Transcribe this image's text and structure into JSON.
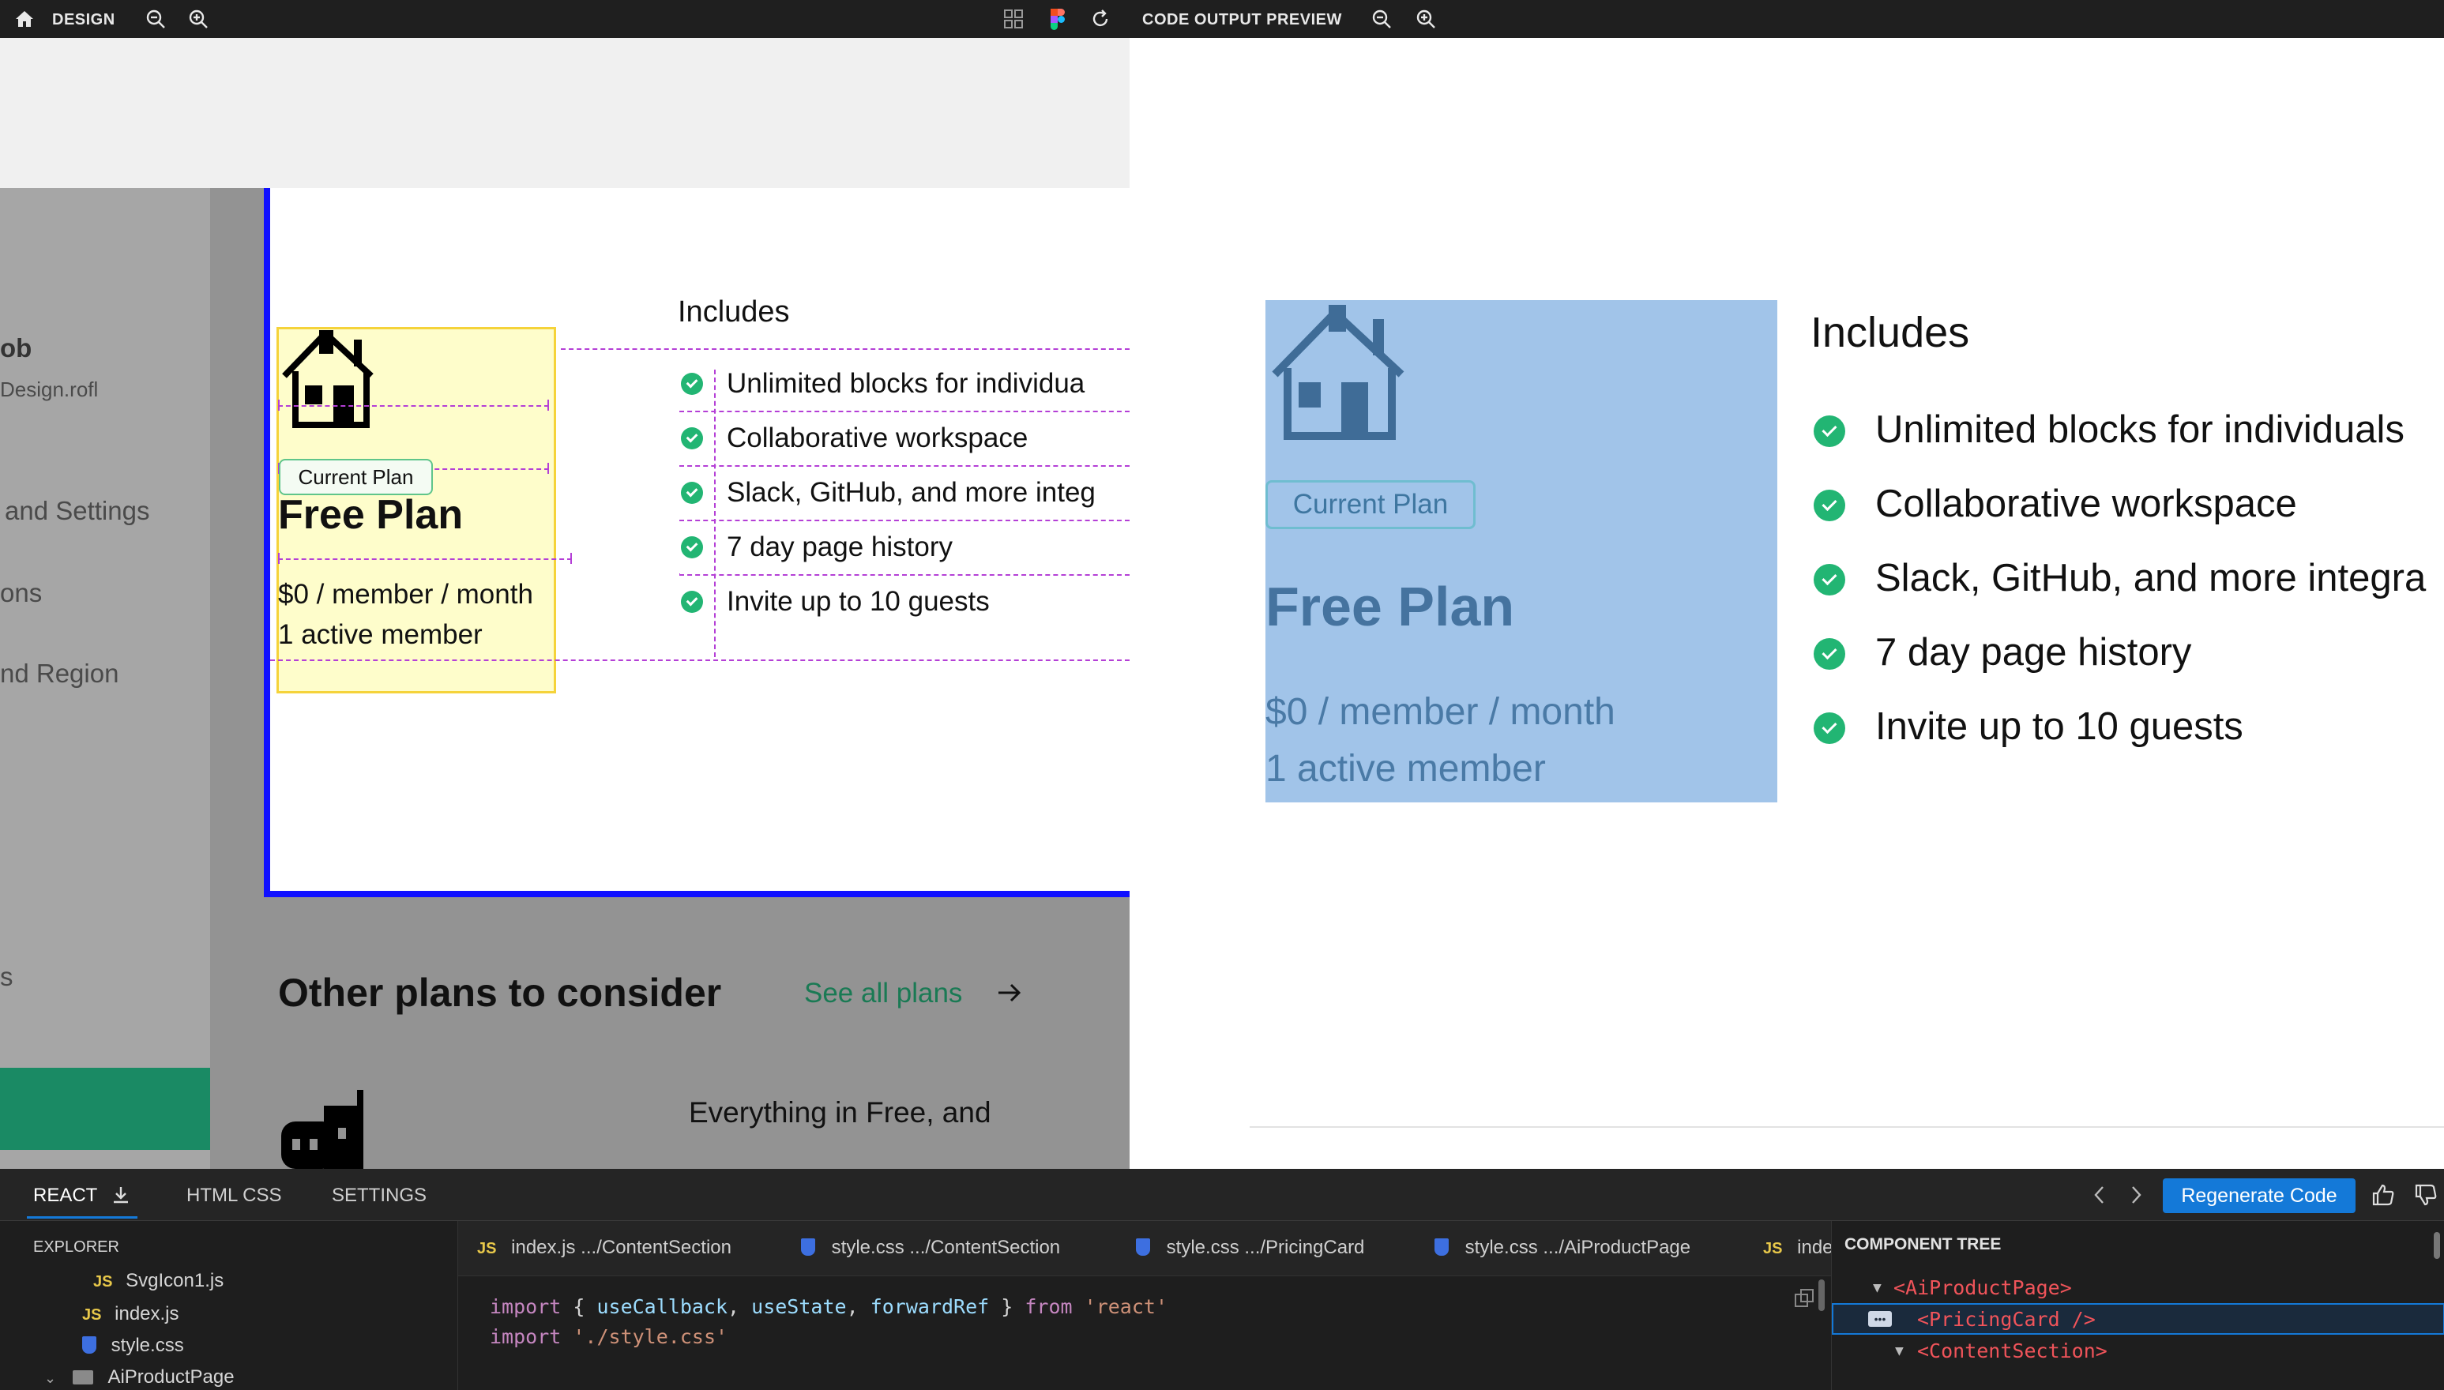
{
  "design_panel": {
    "title": "DESIGN",
    "sidebar": {
      "user_fragment": "ob",
      "subtitle_fragment": "Design.rofl",
      "items": [
        "and Settings",
        "ons",
        "nd Region",
        "s"
      ]
    },
    "pricing_card": {
      "badge": "Current Plan",
      "plan_name": "Free Plan",
      "price": "$0 / member / month",
      "members": "1 active member",
      "includes_title": "Includes",
      "features": [
        "Unlimited blocks for individua",
        "Collaborative workspace",
        "Slack, GitHub, and more integ",
        "7 day page history",
        "Invite up to 10 guests"
      ]
    },
    "other_plans": {
      "title": "Other plans to consider",
      "link": "See all plans",
      "next_card_text": "Everything in Free, and"
    }
  },
  "preview_panel": {
    "title": "CODE OUTPUT PREVIEW",
    "badge": "Current Plan",
    "plan_name": "Free Plan",
    "price": "$0 / member / month",
    "members": "1 active member",
    "includes_title": "Includes",
    "features": [
      "Unlimited blocks for individuals",
      "Collaborative workspace",
      "Slack, GitHub, and more integra",
      "7 day page history",
      "Invite up to 10 guests"
    ]
  },
  "bottom_tabs": {
    "react": "REACT",
    "html_css": "HTML CSS",
    "settings": "SETTINGS",
    "regenerate": "Regenerate Code"
  },
  "explorer": {
    "title": "EXPLORER",
    "files": [
      {
        "type": "JS",
        "name": "SvgIcon1.js"
      },
      {
        "type": "JS",
        "name": "index.js"
      },
      {
        "type": "CSS",
        "name": "style.css"
      },
      {
        "type": "folder",
        "name": "AiProductPage"
      }
    ]
  },
  "file_tabs": [
    {
      "type": "JS",
      "name": "index.js .../ContentSection"
    },
    {
      "type": "CSS",
      "name": "style.css .../ContentSection"
    },
    {
      "type": "CSS",
      "name": "style.css .../PricingCard"
    },
    {
      "type": "CSS",
      "name": "style.css .../AiProductPage"
    },
    {
      "type": "JS",
      "name": "inde"
    }
  ],
  "code": {
    "line1": {
      "import": "import",
      "open": " { ",
      "a": "useCallback",
      "b": "useState",
      "c": "forwardRef",
      "close": " } ",
      "from": "from",
      "src": "'react'"
    },
    "line2": {
      "import": "import",
      "src": "'./style.css'"
    }
  },
  "component_tree": {
    "title": "COMPONENT TREE",
    "nodes": [
      "<AiProductPage>",
      "<PricingCard />",
      "<ContentSection>"
    ]
  },
  "colors": {
    "accent_blue": "#1479d8",
    "check_green": "#22b573",
    "selection_yellow": "#fefdcb",
    "preview_card_blue": "#a1c4e9"
  }
}
